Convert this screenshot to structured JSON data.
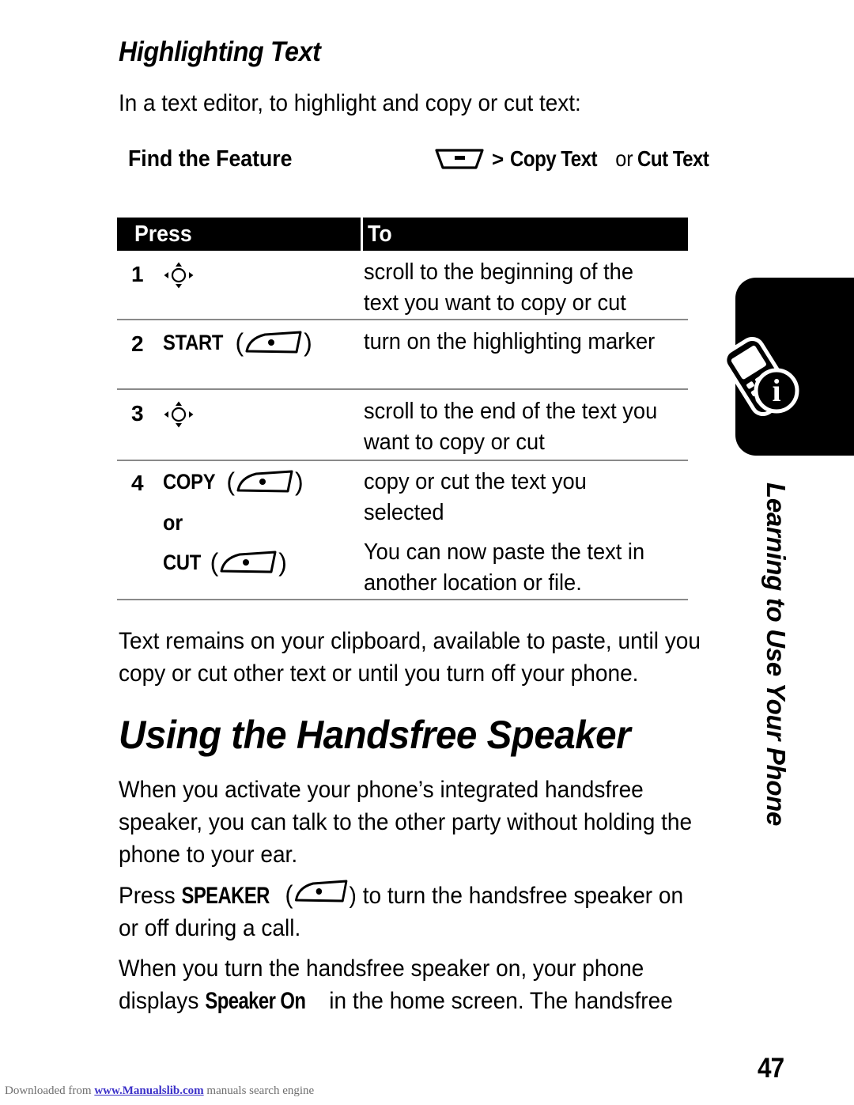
{
  "section": {
    "heading": "Highlighting Text",
    "intro": "In a text editor, to highlight and copy or cut text:"
  },
  "find_the_feature": {
    "label": "Find the Feature",
    "menu_icon": "menu-key-icon",
    "separator": ">",
    "item1": "Copy Text",
    "conjunction": "or",
    "item2": "Cut Text"
  },
  "table": {
    "headers": {
      "press": "Press",
      "to": "To"
    },
    "rows": [
      {
        "num": "1",
        "press_icon": "navigation-key-icon",
        "press_label": "",
        "to": "scroll to the beginning of the text you want to copy or cut"
      },
      {
        "num": "2",
        "press_icon": "soft-key-icon",
        "press_label": "START",
        "to": "turn on the highlighting marker"
      },
      {
        "num": "3",
        "press_icon": "navigation-key-icon",
        "press_label": "",
        "to": "scroll to the end of the text you want to copy or cut"
      },
      {
        "num": "4",
        "press_icon": "soft-key-icon",
        "press_label": "COPY",
        "or_word": "or",
        "press_label2": "CUT",
        "press_icon2": "soft-key-icon",
        "to": "copy or cut the text you selected",
        "to2": "You can now paste the text in another location or file."
      }
    ]
  },
  "body": {
    "clipboard_note": "Text remains on your clipboard, available to paste, until you copy or cut other text or until you turn off your phone.",
    "handsfree_heading": "Using the Handsfree Speaker",
    "para1": "When you activate your phone’s integrated handsfree speaker, you can talk to the other party without holding the phone to your ear.",
    "para2_pre": "Press ",
    "para2_key": "SPEAKER",
    "para2_post": ") to turn the handsfree speaker on or off during a call.",
    "para3_pre": "When you turn the handsfree speaker on, your phone displays ",
    "para3_bold": "Speaker On",
    "para3_post": " in the home screen. The handsfree"
  },
  "side_tab": {
    "label": "Learning to Use Your Phone",
    "icon": "phone-info-icon"
  },
  "footer": {
    "page_number": "47",
    "note_pre": "Downloaded from ",
    "note_link": "www.Manualslib.com",
    "note_post": " manuals search engine"
  },
  "colors": {
    "ink": "#000000",
    "rule": "#8a8a8a",
    "link": "#3b30c8",
    "footer_text": "#6e6e6e"
  }
}
